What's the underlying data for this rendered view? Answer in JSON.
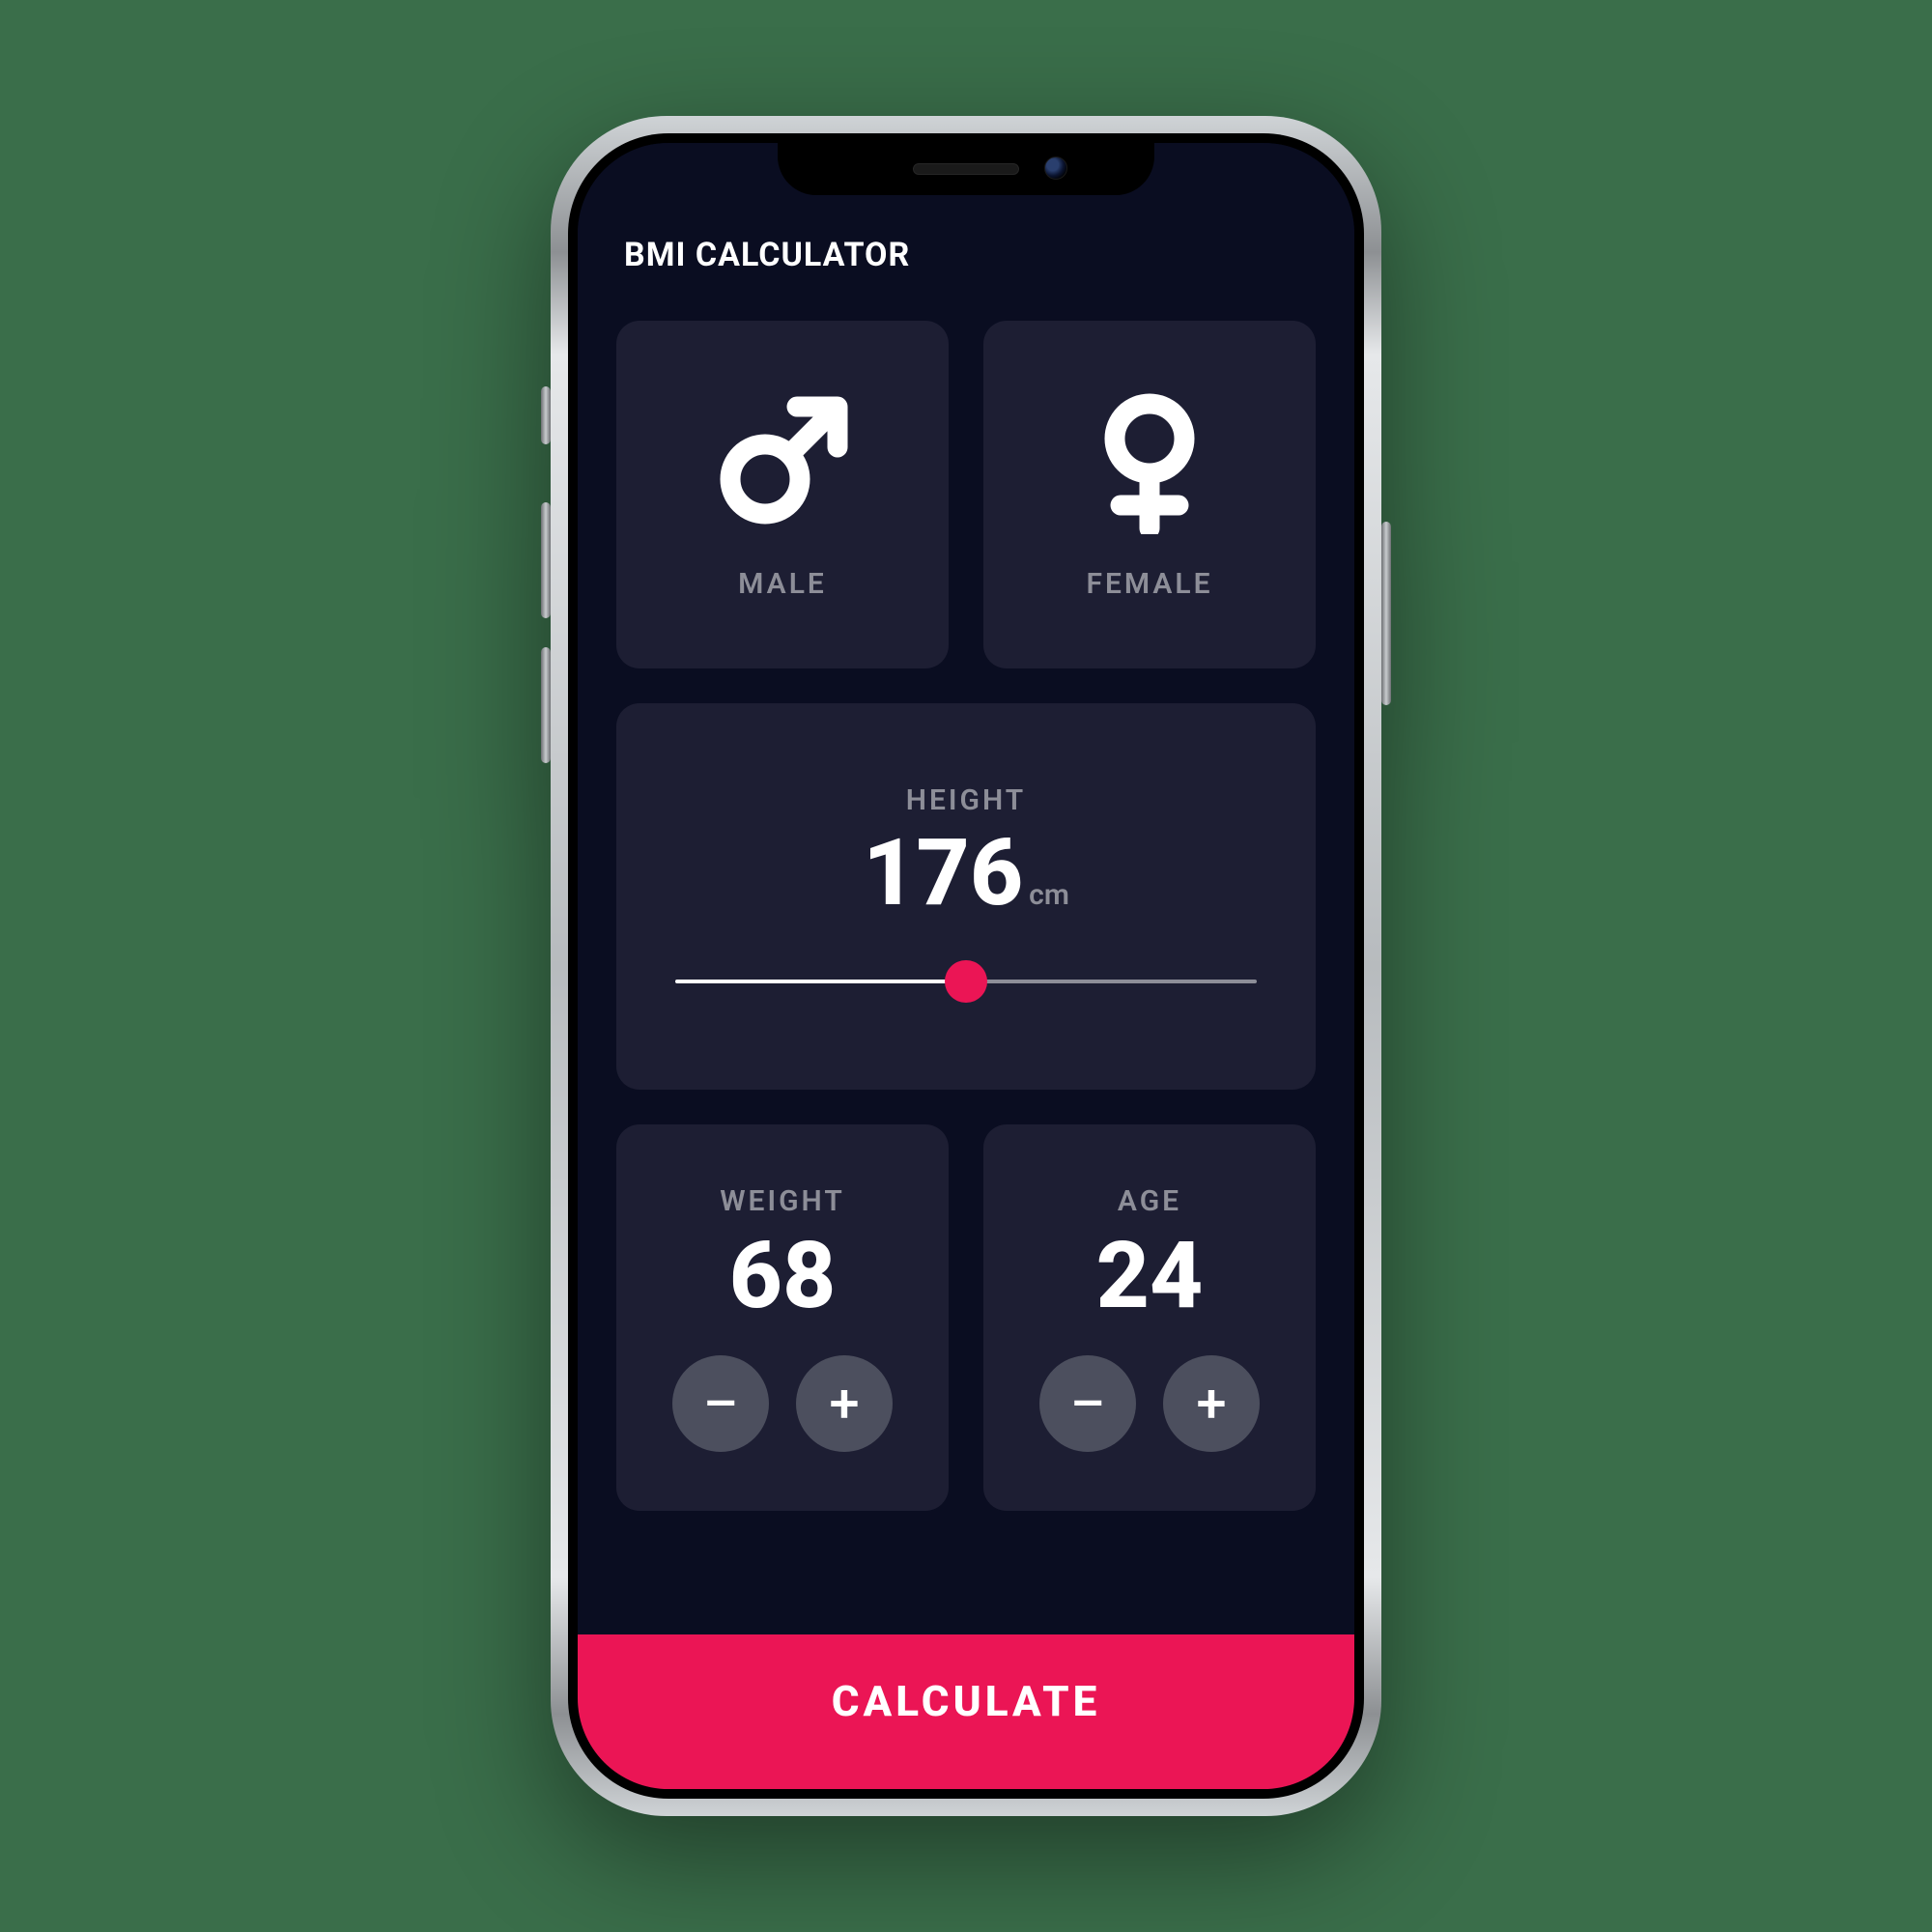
{
  "colors": {
    "app_background": "#0a0d21",
    "card_background": "#1d1e33",
    "label_text": "#8d8e98",
    "accent": "#eb1555",
    "round_button": "#4c4f5e"
  },
  "appbar": {
    "title": "BMI CALCULATOR"
  },
  "gender": {
    "male": {
      "label": "MALE",
      "icon": "male-icon"
    },
    "female": {
      "label": "FEMALE",
      "icon": "female-icon"
    }
  },
  "height": {
    "label": "HEIGHT",
    "value": "176",
    "unit": "cm",
    "slider_position_percent": 50
  },
  "weight": {
    "label": "WEIGHT",
    "value": "68",
    "minus": "–",
    "plus": "+"
  },
  "age": {
    "label": "AGE",
    "value": "24",
    "minus": "–",
    "plus": "+"
  },
  "calculate": {
    "label": "CALCULATE"
  }
}
